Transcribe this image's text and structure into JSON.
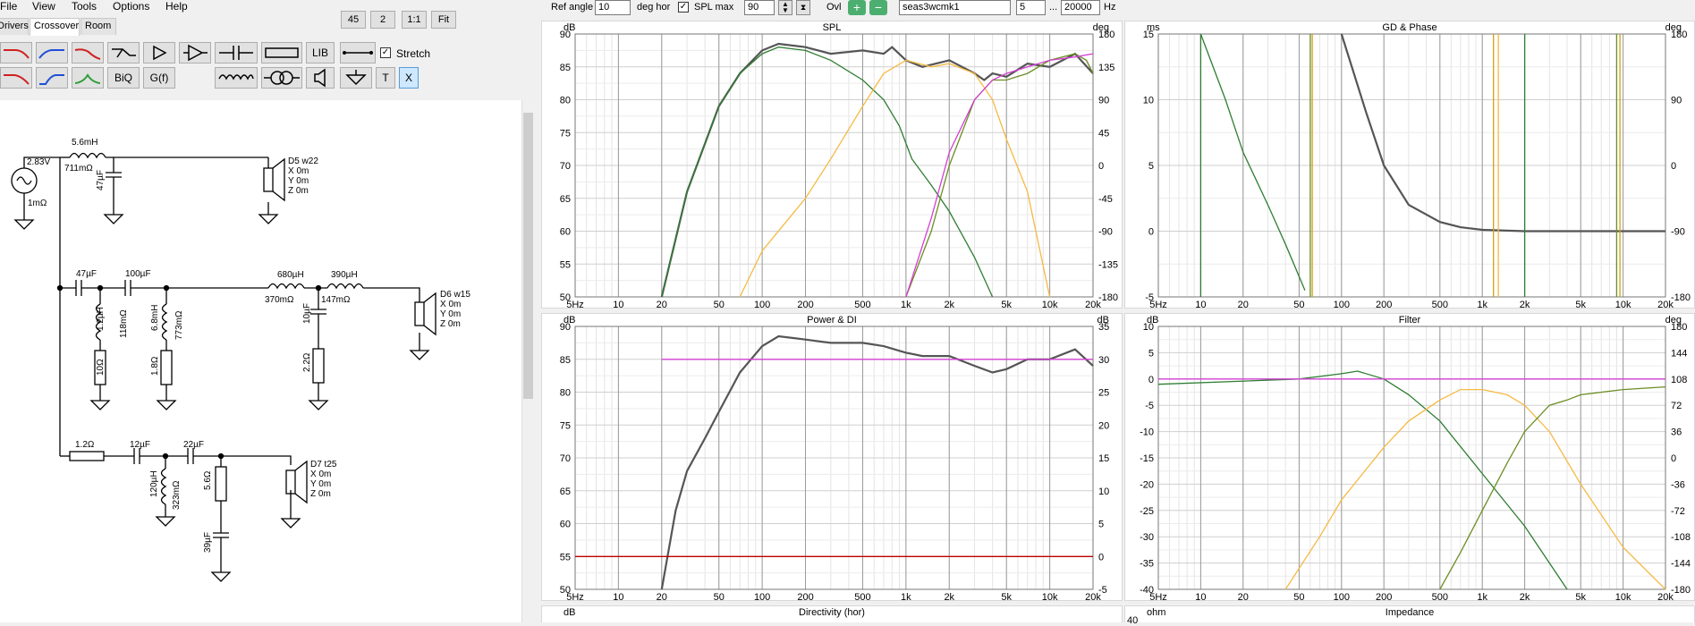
{
  "menu": [
    "File",
    "View",
    "Tools",
    "Options",
    "Help"
  ],
  "tabs": [
    {
      "label": "Drivers",
      "active": false
    },
    {
      "label": "Crossover",
      "active": true
    },
    {
      "label": "Room",
      "active": false
    }
  ],
  "zoom_buttons": [
    "45",
    "2",
    "1:1",
    "Fit"
  ],
  "toolbar": {
    "lib_label": "LIB",
    "biq_label": "BiQ",
    "gf_label": "G(f)",
    "t_label": "T",
    "x_label": "X",
    "stretch_label": "Stretch",
    "stretch_checked": true
  },
  "topbar": {
    "ref_angle_label": "Ref angle",
    "ref_angle_value": "10",
    "deg_hor_label": "deg hor",
    "spl_max_checked": true,
    "spl_max_label": "SPL max",
    "spl_max_value": "90",
    "ovl_label": "Ovl",
    "project_name": "seas3wcmk1",
    "points_value": "5",
    "range_sep": "...",
    "freq_max_value": "20000",
    "hz_label": "Hz"
  },
  "schematic": {
    "source": {
      "voltage": "2.83V",
      "resistance": "1mΩ"
    },
    "labels": {
      "l1": "5.6mH",
      "l1r": "711mΩ",
      "c1": "47µF",
      "d5": [
        "D5 w22",
        "X 0m",
        "Y 0m",
        "Z 0m"
      ],
      "c2": "47µF",
      "c3": "100µF",
      "l2": "1.2µH",
      "l2r": "118mΩ",
      "r1": "10Ω",
      "l3": "6.8mH",
      "l3r": "773mΩ",
      "r2": "1.8Ω",
      "l4": "680µH",
      "l4r": "370mΩ",
      "l5": "390µH",
      "l5r": "147mΩ",
      "c4": "10µF",
      "r3": "2.2Ω",
      "d6": [
        "D6 w15",
        "X 0m",
        "Y 0m",
        "Z 0m"
      ],
      "r4": "1.2Ω",
      "c5": "12µF",
      "c6": "22µF",
      "l6": "120µH",
      "l6r": "323mΩ",
      "r5": "5.6Ω",
      "c7": "39µF",
      "d7": [
        "D7 t25",
        "X 0m",
        "Y 0m",
        "Z 0m"
      ]
    }
  },
  "colors": {
    "woofer": "#2e7d32",
    "mid": "#f5b942",
    "tweeter": "#6b8e23",
    "sum": "#555555",
    "target": "#d43fd4",
    "di": "#c00000",
    "phase": "#d4a017"
  },
  "freq_ticks": [
    "5Hz",
    "10",
    "20",
    "50",
    "100",
    "200",
    "500",
    "1k",
    "2k",
    "5k",
    "10k",
    "20k"
  ],
  "freq_ticks_hz": [
    5,
    10,
    20,
    50,
    100,
    200,
    500,
    1000,
    2000,
    5000,
    10000,
    20000
  ],
  "graphs": {
    "spl": {
      "title": "SPL",
      "unit_left": "dB",
      "unit_right": "deg",
      "y_left": [
        "90",
        "85",
        "80",
        "75",
        "70",
        "65",
        "60",
        "55",
        "50"
      ],
      "y_right": [
        "180",
        "135",
        "90",
        "45",
        "0",
        "-45",
        "-90",
        "-135",
        "-180"
      ]
    },
    "gd": {
      "title": "GD & Phase",
      "unit_left": "ms",
      "unit_right": "deg",
      "y_left": [
        "15",
        "10",
        "5",
        "0",
        "-5"
      ],
      "y_right": [
        "180",
        "90",
        "0",
        "-90",
        "-180"
      ]
    },
    "power": {
      "title": "Power & DI",
      "unit_left": "dB",
      "unit_right": "dB",
      "y_left": [
        "90",
        "85",
        "80",
        "75",
        "70",
        "65",
        "60",
        "55",
        "50"
      ],
      "y_right": [
        "35",
        "30",
        "25",
        "20",
        "15",
        "10",
        "5",
        "0",
        "-5"
      ]
    },
    "filter": {
      "title": "Filter",
      "unit_left": "dB",
      "unit_right": "deg",
      "y_left": [
        "10",
        "5",
        "0",
        "-5",
        "-10",
        "-15",
        "-20",
        "-25",
        "-30",
        "-35",
        "-40"
      ],
      "y_right": [
        "180",
        "144",
        "108",
        "72",
        "36",
        "0",
        "-36",
        "-72",
        "-108",
        "-144",
        "-180"
      ]
    },
    "directivity": {
      "title": "Directivity (hor)",
      "unit_left": "dB"
    },
    "impedance": {
      "title": "Impedance",
      "unit_left": "ohm",
      "y_top": "40"
    }
  },
  "chart_data": [
    {
      "type": "line",
      "title": "SPL",
      "xscale": "log",
      "xlim": [
        5,
        20000
      ],
      "ylim": [
        50,
        90
      ],
      "ylabel": "dB",
      "series": [
        {
          "color": "#555555",
          "x": [
            20,
            30,
            50,
            70,
            100,
            130,
            200,
            300,
            500,
            700,
            800,
            1000,
            1300,
            2000,
            3000,
            3500,
            4000,
            5000,
            7000,
            10000,
            15000,
            20000
          ],
          "y": [
            50,
            66,
            79,
            84,
            87.5,
            88.5,
            88,
            87,
            87.5,
            87,
            88,
            86,
            85,
            86,
            84,
            83,
            84,
            83.5,
            85.5,
            85,
            87,
            84
          ]
        },
        {
          "color": "#2e7d32",
          "x": [
            20,
            30,
            50,
            70,
            100,
            130,
            200,
            300,
            500,
            700,
            900,
            1100,
            1500,
            2000,
            3000,
            4000
          ],
          "y": [
            50,
            66,
            79,
            84,
            87,
            88,
            87.5,
            86,
            83,
            80,
            76,
            71,
            67,
            63,
            56,
            50
          ]
        },
        {
          "color": "#f5b942",
          "x": [
            70,
            100,
            200,
            300,
            500,
            700,
            1000,
            1500,
            2000,
            3000,
            4000,
            5000,
            7000,
            10000
          ],
          "y": [
            50,
            57,
            65,
            71,
            79,
            84,
            86,
            85,
            85.5,
            84,
            80,
            74,
            66,
            50
          ]
        },
        {
          "color": "#6b8e23",
          "x": [
            1000,
            1500,
            2000,
            3000,
            4000,
            5000,
            7000,
            10000,
            15000,
            18000,
            20000
          ],
          "y": [
            50,
            60,
            70,
            80,
            83,
            83,
            84,
            86,
            87,
            86,
            84
          ]
        },
        {
          "color": "#d43fd4",
          "x": [
            1000,
            1500,
            2000,
            3000,
            4000,
            5000,
            7000,
            10000,
            15000,
            20000
          ],
          "y": [
            50,
            62,
            72,
            80,
            83,
            84,
            85,
            86,
            86.5,
            87
          ]
        }
      ]
    },
    {
      "type": "line",
      "title": "Power & DI",
      "xscale": "log",
      "xlim": [
        5,
        20000
      ],
      "ylim": [
        50,
        90
      ],
      "ylabel": "dB",
      "series": [
        {
          "color": "#555555",
          "x": [
            20,
            25,
            30,
            40,
            50,
            70,
            100,
            130,
            200,
            300,
            500,
            700,
            1000,
            1300,
            2000,
            3000,
            4000,
            5000,
            7000,
            10000,
            15000,
            20000
          ],
          "y": [
            50,
            62,
            68,
            73,
            77,
            83,
            87,
            88.5,
            88,
            87.5,
            87.5,
            87,
            86,
            85.5,
            85.5,
            84,
            83,
            83.5,
            85,
            85,
            86.5,
            84
          ]
        },
        {
          "color": "#d43fd4",
          "x": [
            20,
            20000
          ],
          "y": [
            85,
            85
          ]
        },
        {
          "color": "#c00000",
          "x": [
            5,
            20000
          ],
          "y": [
            55,
            55
          ]
        }
      ]
    },
    {
      "type": "line",
      "title": "GD & Phase",
      "xscale": "log",
      "xlim": [
        5,
        20000
      ],
      "ylim": [
        -5,
        15
      ],
      "ylabel": "ms",
      "series": [
        {
          "color": "#555555",
          "x": [
            100,
            150,
            200,
            300,
            500,
            700,
            1000,
            2000,
            5000,
            20000
          ],
          "y": [
            15,
            9,
            5,
            2,
            0.7,
            0.3,
            0.1,
            0,
            0,
            0
          ]
        },
        {
          "color": "#2e7d32",
          "x": [
            10,
            15,
            20,
            30,
            40,
            55
          ],
          "y": [
            15,
            10,
            6,
            2,
            -1,
            -4.5
          ]
        }
      ]
    },
    {
      "type": "line",
      "title": "Filter",
      "xscale": "log",
      "xlim": [
        5,
        20000
      ],
      "ylim": [
        -40,
        10
      ],
      "ylabel": "dB",
      "series": [
        {
          "color": "#2e7d32",
          "x": [
            5,
            50,
            100,
            130,
            200,
            300,
            500,
            1000,
            2000,
            3000,
            4000
          ],
          "y": [
            -1,
            0,
            1,
            1.5,
            0,
            -3,
            -8,
            -18,
            -28,
            -35,
            -40
          ]
        },
        {
          "color": "#f5b942",
          "x": [
            40,
            70,
            100,
            200,
            300,
            500,
            700,
            1000,
            1500,
            2000,
            3000,
            5000,
            10000,
            20000
          ],
          "y": [
            -40,
            -30,
            -23,
            -13,
            -8,
            -4,
            -2,
            -2,
            -3,
            -5,
            -10,
            -20,
            -32,
            -40
          ]
        },
        {
          "color": "#6b8e23",
          "x": [
            500,
            700,
            1000,
            1500,
            2000,
            3000,
            4000,
            5000,
            10000,
            20000
          ],
          "y": [
            -40,
            -33,
            -25,
            -16,
            -10,
            -5,
            -4,
            -3,
            -2,
            -1.5
          ]
        },
        {
          "color": "#d43fd4",
          "x": [
            5,
            20000
          ],
          "y": [
            0,
            0
          ]
        }
      ]
    }
  ]
}
